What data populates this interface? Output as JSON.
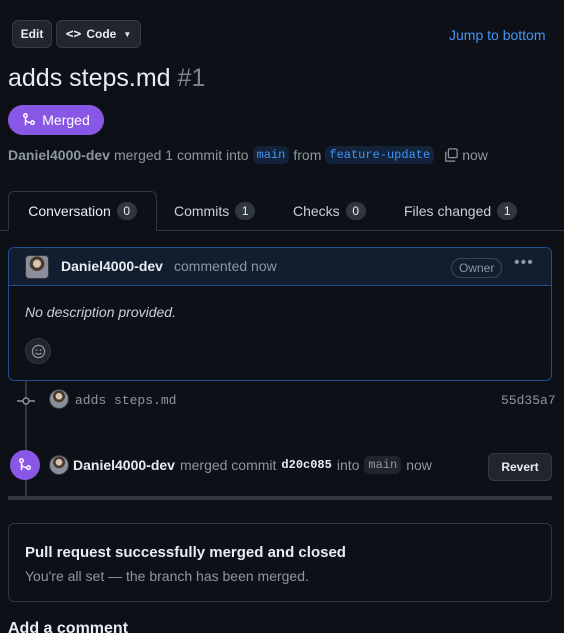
{
  "toolbar": {
    "edit_label": "Edit",
    "code_label": "Code",
    "jump_label": "Jump to bottom"
  },
  "pr": {
    "title": "adds steps.md",
    "number": "#1",
    "state_label": "Merged",
    "author": "Daniel4000-dev",
    "merged_text": "merged 1 commit into",
    "base_branch": "main",
    "from_text": "from",
    "head_branch": "feature-update",
    "time": "now"
  },
  "tabs": [
    {
      "label": "Conversation",
      "count": "0"
    },
    {
      "label": "Commits",
      "count": "1"
    },
    {
      "label": "Checks",
      "count": "0"
    },
    {
      "label": "Files changed",
      "count": "1"
    }
  ],
  "comment": {
    "author": "Daniel4000-dev",
    "action": "commented now",
    "badge": "Owner",
    "body": "No description provided."
  },
  "commit": {
    "message": "adds steps.md",
    "sha": "55d35a7"
  },
  "merge_event": {
    "author": "Daniel4000-dev",
    "text": "merged commit",
    "sha": "d20c085",
    "into_text": "into",
    "branch": "main",
    "time": "now",
    "revert_label": "Revert"
  },
  "merged_box": {
    "title": "Pull request successfully merged and closed",
    "subtitle": "You're all set — the branch has been merged."
  },
  "add_comment": {
    "heading": "Add a comment"
  },
  "colors": {
    "merged": "#8957e5",
    "link": "#4493f8",
    "background": "#0d1117"
  }
}
